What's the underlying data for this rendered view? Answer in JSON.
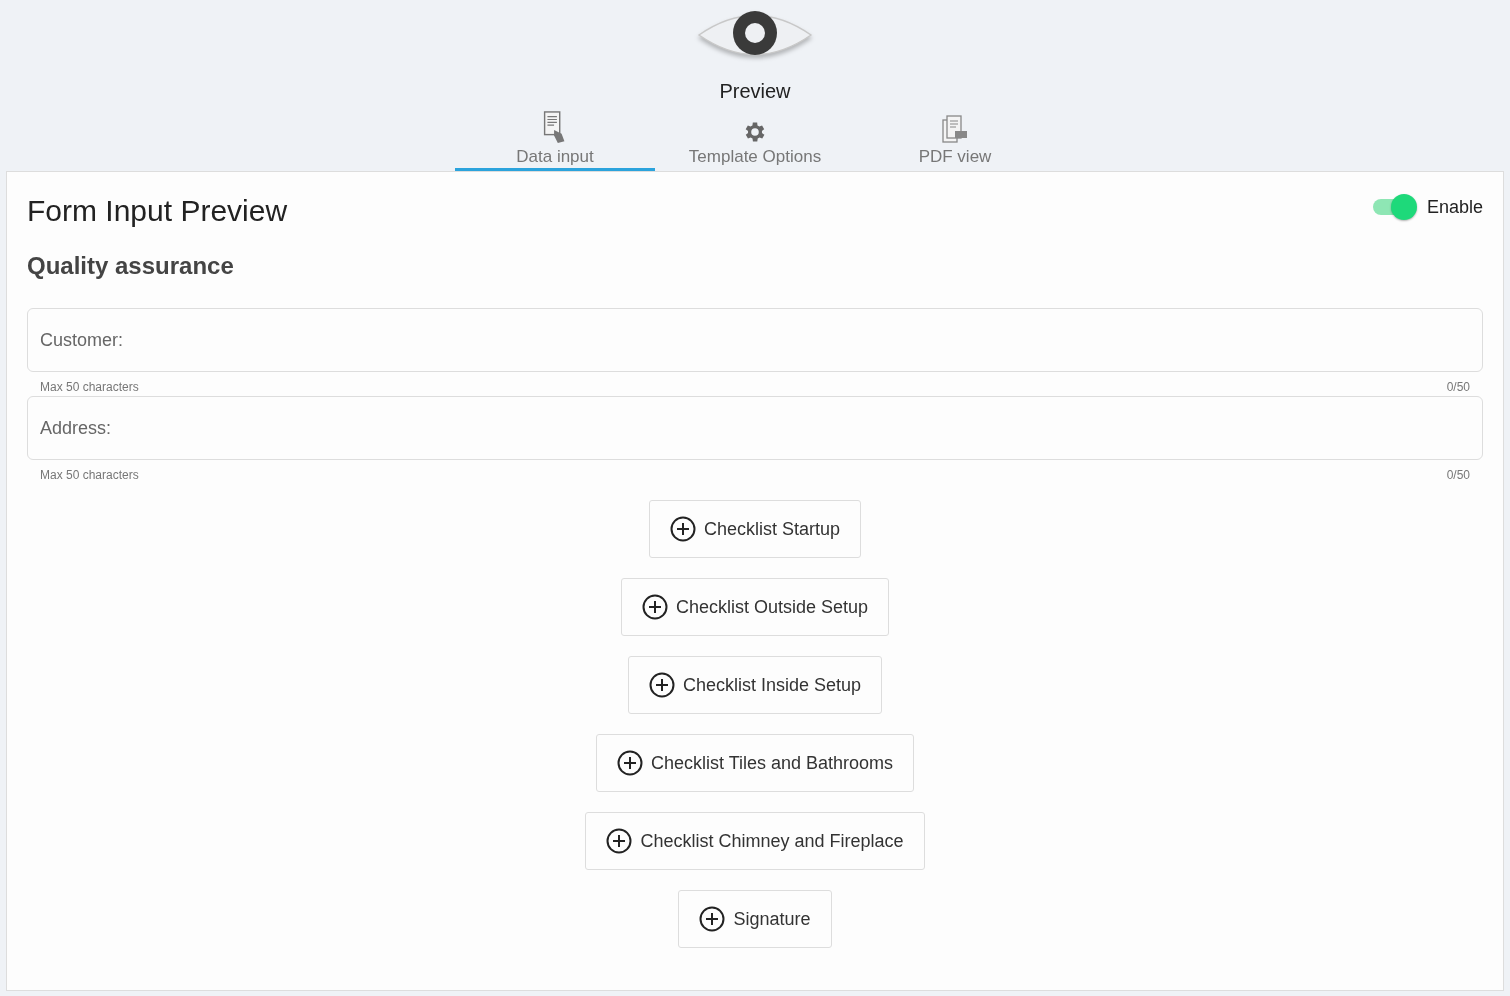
{
  "header": {
    "title": "Preview"
  },
  "tabs": [
    {
      "label": "Data input",
      "kind": "document",
      "selected": true
    },
    {
      "label": "Template Options",
      "kind": "gear",
      "selected": false
    },
    {
      "label": "PDF view",
      "kind": "pdf",
      "selected": false
    }
  ],
  "form": {
    "title": "Form Input Preview",
    "enable": {
      "label": "Enable",
      "on": true
    },
    "subtitle": "Quality assurance",
    "fields": [
      {
        "placeholder": "Customer:",
        "hint": "Max 50 characters",
        "counter": "0/50"
      },
      {
        "placeholder": "Address:",
        "hint": "Max 50 characters",
        "counter": "0/50"
      }
    ],
    "buttons": [
      "Checklist Startup",
      "Checklist Outside Setup",
      "Checklist Inside Setup",
      "Checklist Tiles and Bathrooms",
      "Checklist Chimney and Fireplace",
      "Signature"
    ]
  }
}
